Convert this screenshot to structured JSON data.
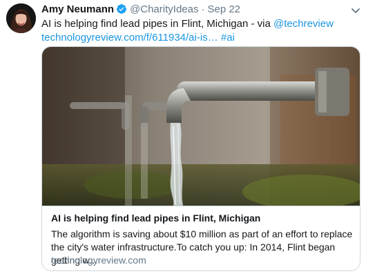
{
  "tweet": {
    "author_name": "Amy Neumann",
    "handle": "@CharityIdeas",
    "separator": "·",
    "timestamp": "Sep 22",
    "text_main": "AI is helping find lead pipes in Flint, Michigan - via ",
    "mention": "@techreview",
    "link_url": "technologyreview.com/f/611934/ai-is…",
    "hashtag": "#ai"
  },
  "card": {
    "title": "AI is helping find lead pipes in Flint, Michigan",
    "description": "The algorithm is saving about $10 million as part of an effort to replace the city's water infrastructure.To catch you up: In 2014, Flint began getting w...",
    "domain": "technologyreview.com",
    "image_icon": "water-faucets-photo"
  },
  "colors": {
    "link": "#1b95e0",
    "secondary_text": "#657786",
    "verified": "#1da1f2",
    "border": "#ccd6dd"
  }
}
